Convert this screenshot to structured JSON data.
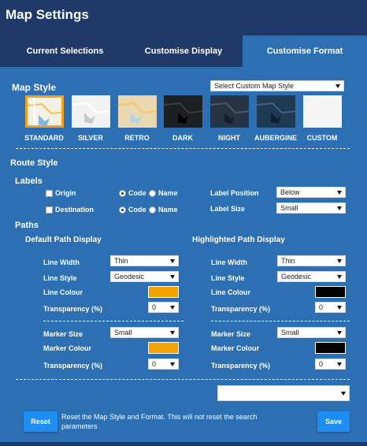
{
  "header": {
    "title": "Map Settings"
  },
  "tabs": [
    {
      "label": "Current Selections"
    },
    {
      "label": "Customise Display"
    },
    {
      "label": "Customise Format"
    }
  ],
  "map_style": {
    "title": "Map Style",
    "select_value": "Select Custom Map Style",
    "styles": [
      {
        "label": "STANDARD"
      },
      {
        "label": "SILVER"
      },
      {
        "label": "RETRO"
      },
      {
        "label": "DARK"
      },
      {
        "label": "NIGHT"
      },
      {
        "label": "AUBERGINE"
      },
      {
        "label": "CUSTOM"
      }
    ]
  },
  "route_style": {
    "title": "Route Style",
    "labels": {
      "title": "Labels",
      "origin": "Origin",
      "destination": "Destination",
      "code": "Code",
      "name": "Name",
      "label_position": "Label Position",
      "label_position_value": "Below",
      "label_size": "Label Size",
      "label_size_value": "Small"
    },
    "paths": {
      "title": "Paths",
      "default_title": "Default Path Display",
      "highlighted_title": "Highlighted Path Display",
      "line_width": "Line Width",
      "line_style": "Line Style",
      "line_colour": "Line Colour",
      "transparency": "Transparency (%)",
      "marker_size": "Marker Size",
      "marker_colour": "Marker Colour",
      "default": {
        "line_width_value": "Thin",
        "line_style_value": "Geodesic",
        "line_colour": "#f5a300",
        "transparency_value": "0",
        "marker_size_value": "Small",
        "marker_colour": "#f5a300",
        "marker_transparency_value": "0"
      },
      "highlighted": {
        "line_width_value": "Thin",
        "line_style_value": "Geodesic",
        "line_colour": "#000000",
        "transparency_value": "0",
        "marker_size_value": "Small",
        "marker_colour": "#000000",
        "marker_transparency_value": "0"
      }
    }
  },
  "footer": {
    "preset_select_value": "",
    "reset_label": "Reset",
    "reset_note": "Reset the Map Style and Format. This will not reset the search parameters",
    "save_label": "Save"
  },
  "colors": {
    "background": "#2d6fb3",
    "header": "#1f3a68",
    "accent": "#f0a21e",
    "button": "#1e8ef2"
  }
}
